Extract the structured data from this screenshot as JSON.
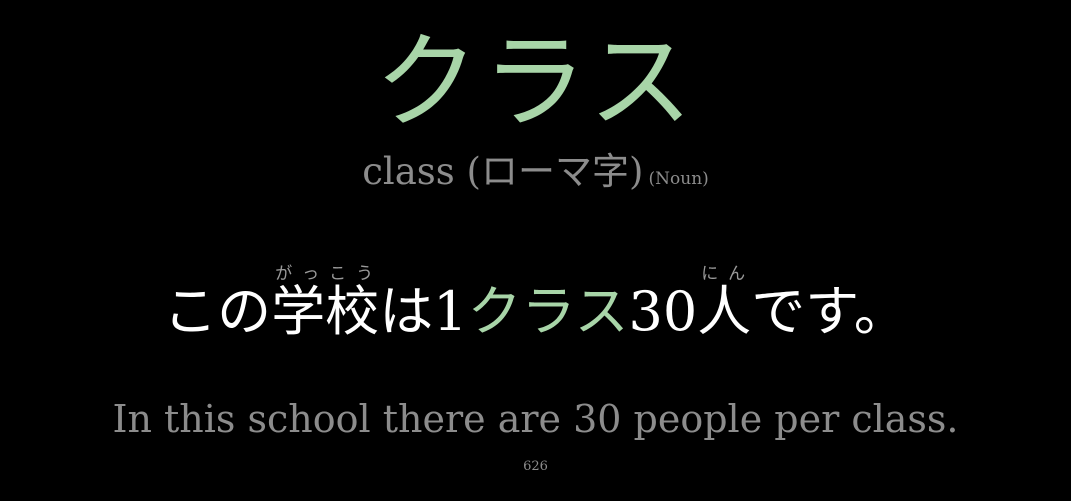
{
  "card": {
    "headword": "クラス",
    "meaning": "class (ローマ字)",
    "part_of_speech": "(Noun)",
    "sentence": {
      "part1": "この",
      "word1": "学校",
      "word1_reading": "がっこう",
      "part2": "は1",
      "highlight": "クラス",
      "part3": "30",
      "word2": "人",
      "word2_reading": "にん",
      "part4": "です。"
    },
    "translation": "In this school there are 30 people per class.",
    "number": "626"
  },
  "colors": {
    "background": "#000000",
    "accent": "#a8d5a8",
    "primary_text": "#ffffff",
    "secondary_text": "#8c8c8c"
  }
}
